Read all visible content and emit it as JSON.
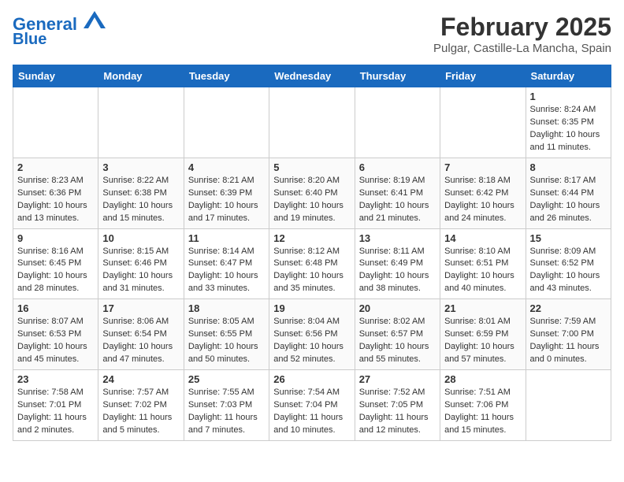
{
  "header": {
    "logo_line1": "General",
    "logo_line2": "Blue",
    "month": "February 2025",
    "location": "Pulgar, Castille-La Mancha, Spain"
  },
  "weekdays": [
    "Sunday",
    "Monday",
    "Tuesday",
    "Wednesday",
    "Thursday",
    "Friday",
    "Saturday"
  ],
  "weeks": [
    [
      {
        "day": "",
        "info": ""
      },
      {
        "day": "",
        "info": ""
      },
      {
        "day": "",
        "info": ""
      },
      {
        "day": "",
        "info": ""
      },
      {
        "day": "",
        "info": ""
      },
      {
        "day": "",
        "info": ""
      },
      {
        "day": "1",
        "info": "Sunrise: 8:24 AM\nSunset: 6:35 PM\nDaylight: 10 hours and 11 minutes."
      }
    ],
    [
      {
        "day": "2",
        "info": "Sunrise: 8:23 AM\nSunset: 6:36 PM\nDaylight: 10 hours and 13 minutes."
      },
      {
        "day": "3",
        "info": "Sunrise: 8:22 AM\nSunset: 6:38 PM\nDaylight: 10 hours and 15 minutes."
      },
      {
        "day": "4",
        "info": "Sunrise: 8:21 AM\nSunset: 6:39 PM\nDaylight: 10 hours and 17 minutes."
      },
      {
        "day": "5",
        "info": "Sunrise: 8:20 AM\nSunset: 6:40 PM\nDaylight: 10 hours and 19 minutes."
      },
      {
        "day": "6",
        "info": "Sunrise: 8:19 AM\nSunset: 6:41 PM\nDaylight: 10 hours and 21 minutes."
      },
      {
        "day": "7",
        "info": "Sunrise: 8:18 AM\nSunset: 6:42 PM\nDaylight: 10 hours and 24 minutes."
      },
      {
        "day": "8",
        "info": "Sunrise: 8:17 AM\nSunset: 6:44 PM\nDaylight: 10 hours and 26 minutes."
      }
    ],
    [
      {
        "day": "9",
        "info": "Sunrise: 8:16 AM\nSunset: 6:45 PM\nDaylight: 10 hours and 28 minutes."
      },
      {
        "day": "10",
        "info": "Sunrise: 8:15 AM\nSunset: 6:46 PM\nDaylight: 10 hours and 31 minutes."
      },
      {
        "day": "11",
        "info": "Sunrise: 8:14 AM\nSunset: 6:47 PM\nDaylight: 10 hours and 33 minutes."
      },
      {
        "day": "12",
        "info": "Sunrise: 8:12 AM\nSunset: 6:48 PM\nDaylight: 10 hours and 35 minutes."
      },
      {
        "day": "13",
        "info": "Sunrise: 8:11 AM\nSunset: 6:49 PM\nDaylight: 10 hours and 38 minutes."
      },
      {
        "day": "14",
        "info": "Sunrise: 8:10 AM\nSunset: 6:51 PM\nDaylight: 10 hours and 40 minutes."
      },
      {
        "day": "15",
        "info": "Sunrise: 8:09 AM\nSunset: 6:52 PM\nDaylight: 10 hours and 43 minutes."
      }
    ],
    [
      {
        "day": "16",
        "info": "Sunrise: 8:07 AM\nSunset: 6:53 PM\nDaylight: 10 hours and 45 minutes."
      },
      {
        "day": "17",
        "info": "Sunrise: 8:06 AM\nSunset: 6:54 PM\nDaylight: 10 hours and 47 minutes."
      },
      {
        "day": "18",
        "info": "Sunrise: 8:05 AM\nSunset: 6:55 PM\nDaylight: 10 hours and 50 minutes."
      },
      {
        "day": "19",
        "info": "Sunrise: 8:04 AM\nSunset: 6:56 PM\nDaylight: 10 hours and 52 minutes."
      },
      {
        "day": "20",
        "info": "Sunrise: 8:02 AM\nSunset: 6:57 PM\nDaylight: 10 hours and 55 minutes."
      },
      {
        "day": "21",
        "info": "Sunrise: 8:01 AM\nSunset: 6:59 PM\nDaylight: 10 hours and 57 minutes."
      },
      {
        "day": "22",
        "info": "Sunrise: 7:59 AM\nSunset: 7:00 PM\nDaylight: 11 hours and 0 minutes."
      }
    ],
    [
      {
        "day": "23",
        "info": "Sunrise: 7:58 AM\nSunset: 7:01 PM\nDaylight: 11 hours and 2 minutes."
      },
      {
        "day": "24",
        "info": "Sunrise: 7:57 AM\nSunset: 7:02 PM\nDaylight: 11 hours and 5 minutes."
      },
      {
        "day": "25",
        "info": "Sunrise: 7:55 AM\nSunset: 7:03 PM\nDaylight: 11 hours and 7 minutes."
      },
      {
        "day": "26",
        "info": "Sunrise: 7:54 AM\nSunset: 7:04 PM\nDaylight: 11 hours and 10 minutes."
      },
      {
        "day": "27",
        "info": "Sunrise: 7:52 AM\nSunset: 7:05 PM\nDaylight: 11 hours and 12 minutes."
      },
      {
        "day": "28",
        "info": "Sunrise: 7:51 AM\nSunset: 7:06 PM\nDaylight: 11 hours and 15 minutes."
      },
      {
        "day": "",
        "info": ""
      }
    ]
  ]
}
